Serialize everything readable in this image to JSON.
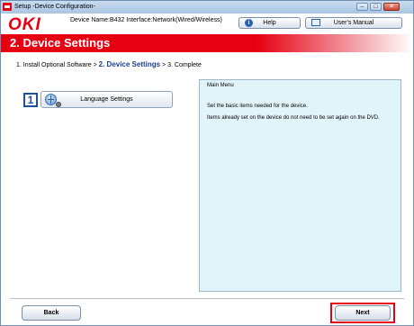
{
  "window": {
    "title": "Setup -Device Configuration-",
    "minimize": "–",
    "maximize": "□",
    "close": "✕"
  },
  "header": {
    "logo": "OKI",
    "device_name": "Device Name:B432 Interface:Network(Wired/Wireless)",
    "help_label": "Help",
    "manual_label": "User's Manual",
    "help_icon_glyph": "i"
  },
  "banner": {
    "title": "2. Device Settings"
  },
  "breadcrumb": {
    "step1": "1. Install Optional Software > ",
    "step2": "2. Device Settings",
    "step3": " > 3. Complete"
  },
  "settings": {
    "items": [
      {
        "number": "1",
        "label": "Language Settings",
        "icon": "globe-settings-icon"
      }
    ]
  },
  "description": {
    "heading": "Main Menu",
    "line1": "Set the basic items needed for the device.",
    "line2": "Items already set on the device do not need to be set again on the DVD."
  },
  "footer": {
    "back_label": "Back",
    "next_label": "Next"
  },
  "colors": {
    "brand_red": "#e60012",
    "panel_bg": "#e1f4f9",
    "accent_blue": "#1f4fa0"
  }
}
